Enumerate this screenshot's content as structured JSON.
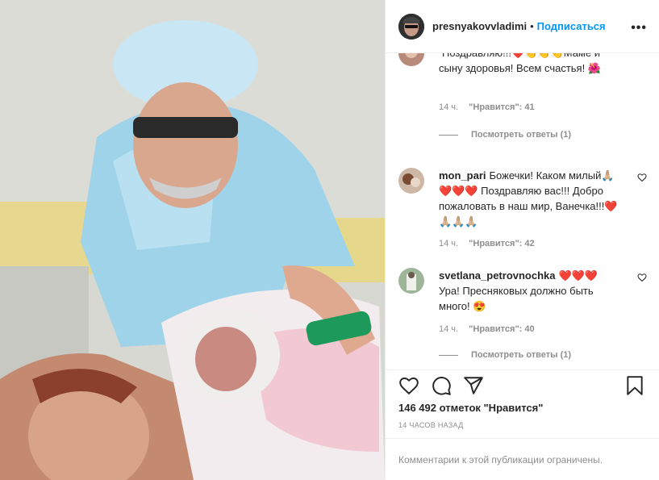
{
  "header": {
    "username": "presnyakovvladimi",
    "separator": "•",
    "follow_label": "Подписаться",
    "more_label": "•••"
  },
  "comments": [
    {
      "username": "",
      "text": "Поздравляю!!!❤️👏👏👏Маме и сыну здоровья! Всем счастья! 🌺",
      "time": "14 ч.",
      "likes": "\"Нравится\": 41",
      "replies": "Посмотреть ответы (1)"
    },
    {
      "username": "mon_pari",
      "text": "Божечки! Каком милый🙏🏼❤️❤️❤️ Поздравляю вас!!! Добро пожаловать в наш мир, Ванечка!!!❤️🙏🏼🙏🏼🙏🏼",
      "time": "14 ч.",
      "likes": "\"Нравится\": 42",
      "replies": ""
    },
    {
      "username": "svetlana_petrovnochka",
      "text": "❤️❤️❤️ Ура! Пресняковых должно быть много! 😍",
      "time": "14 ч.",
      "likes": "\"Нравится\": 40",
      "replies": "Посмотреть ответы (1)"
    }
  ],
  "post": {
    "likes_count": "146 492 отметок \"Нравится\"",
    "time_ago": "14 ЧАСОВ НАЗАД",
    "restricted_notice": "Комментарии к этой публикации ограничены."
  },
  "icons": {
    "like": "heart-icon",
    "comment": "comment-icon",
    "share": "share-icon",
    "save": "bookmark-icon",
    "comment_like": "heart-outline-icon"
  },
  "colors": {
    "accent": "#0095f6",
    "text": "#262626",
    "muted": "#8e8e8e",
    "border": "#efefef"
  }
}
